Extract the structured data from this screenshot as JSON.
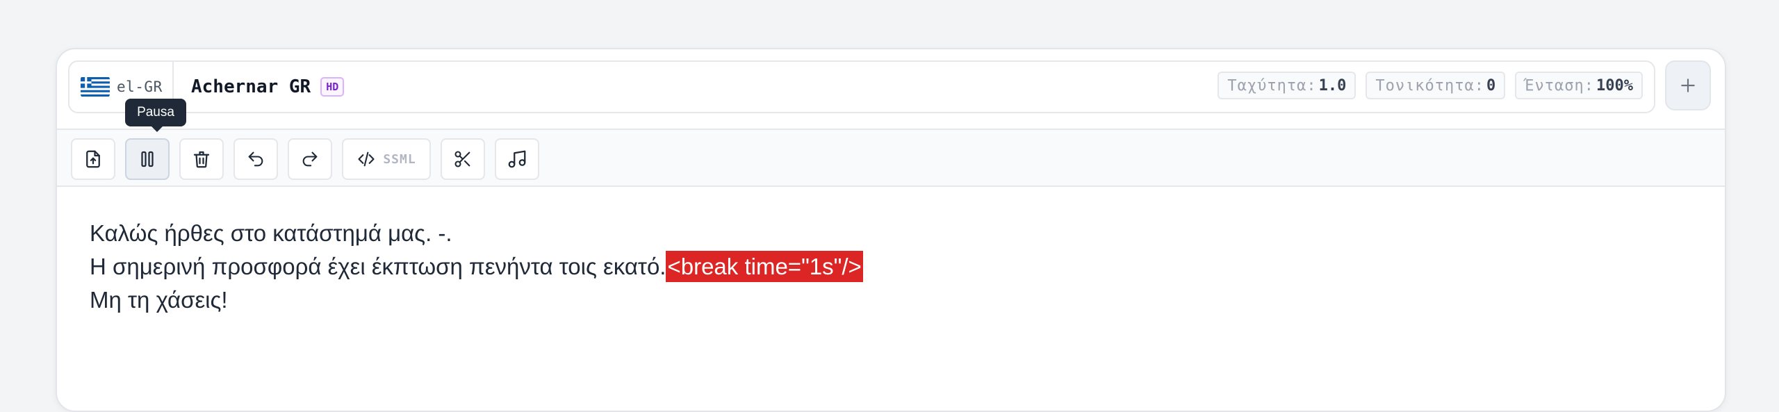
{
  "header": {
    "language_code": "el-GR",
    "voice_name": "Achernar GR",
    "voice_badge": "HD",
    "params": [
      {
        "label": "Ταχύτητα",
        "value": "1.0"
      },
      {
        "label": "Τονικότητα",
        "value": "0"
      },
      {
        "label": "Ένταση",
        "value": "100%"
      }
    ],
    "add_icon": "plus-icon"
  },
  "toolbar": {
    "buttons": [
      {
        "icon": "file-upload-icon"
      },
      {
        "icon": "pause-icon",
        "tooltip": "Pausa",
        "active": true
      },
      {
        "icon": "trash-icon"
      },
      {
        "icon": "undo-icon"
      },
      {
        "icon": "redo-icon"
      },
      {
        "icon": "code-icon",
        "label": "SSML"
      },
      {
        "icon": "scissors-icon"
      },
      {
        "icon": "music-icon"
      }
    ]
  },
  "editor": {
    "line1": "Καλώς ήρθες στο κατάστημά μας. -.",
    "line2_text": "Η σημερινή προσφορά έχει έκπτωση πενήντα τοις εκατό.",
    "line2_tag": "<break time=\"1s\"/>",
    "line3": "Μη τη χάσεις!"
  },
  "colors": {
    "ssml_highlight": "#dc2626",
    "hd_badge": "#7e22ce",
    "tooltip_bg": "#1f2937"
  }
}
